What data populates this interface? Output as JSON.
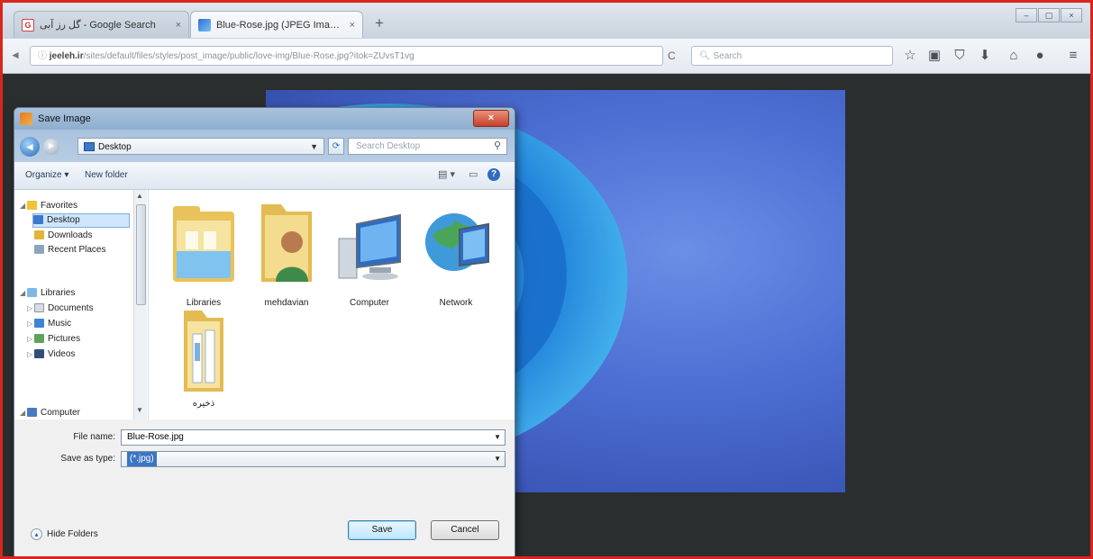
{
  "browser": {
    "tabs": [
      {
        "label": "گل رز آبی - Google Search",
        "close": "×"
      },
      {
        "label": "Blue-Rose.jpg (JPEG Image...",
        "close": "×"
      }
    ],
    "new_tab": "+",
    "url_domain": "jeeleh.ir",
    "url_path": "/sites/default/files/styles/post_image/public/love-img/Blue-Rose.jpg?itok=ZUvsT1vg",
    "search_placeholder": "Search",
    "window_controls": [
      "–",
      "▢",
      "×"
    ],
    "toolbar_icons": [
      "star-icon",
      "clipboard-icon",
      "pocket-icon",
      "download-icon",
      "home-icon",
      "addon-icon",
      "menu-icon"
    ]
  },
  "page": {
    "image_description_color": "#4d6fd4"
  },
  "dialog": {
    "title": "Save Image",
    "close_glyph": "×",
    "location": "Desktop",
    "search_placeholder": "Search Desktop",
    "commands": {
      "organize": "Organize ▾",
      "new_folder": "New folder"
    },
    "nav": {
      "favorites": "Favorites",
      "desktop": "Desktop",
      "downloads": "Downloads",
      "recent_places": "Recent Places",
      "libraries": "Libraries",
      "documents": "Documents",
      "music": "Music",
      "pictures": "Pictures",
      "videos": "Videos",
      "computer": "Computer"
    },
    "files": [
      {
        "label": "Libraries",
        "icon": "libraries-folder-icon"
      },
      {
        "label": "mehdavian",
        "icon": "user-folder-icon"
      },
      {
        "label": "Computer",
        "icon": "computer-icon"
      },
      {
        "label": "Network",
        "icon": "network-icon"
      },
      {
        "label": "ذخیره",
        "icon": "folder-icon"
      }
    ],
    "form": {
      "file_name_label": "File name:",
      "file_name_value": "Blue-Rose.jpg",
      "save_type_label": "Save as type:",
      "save_type_value": "(*.jpg)"
    },
    "hide_folders": "Hide Folders",
    "save_label": "Save",
    "cancel_label": "Cancel"
  }
}
